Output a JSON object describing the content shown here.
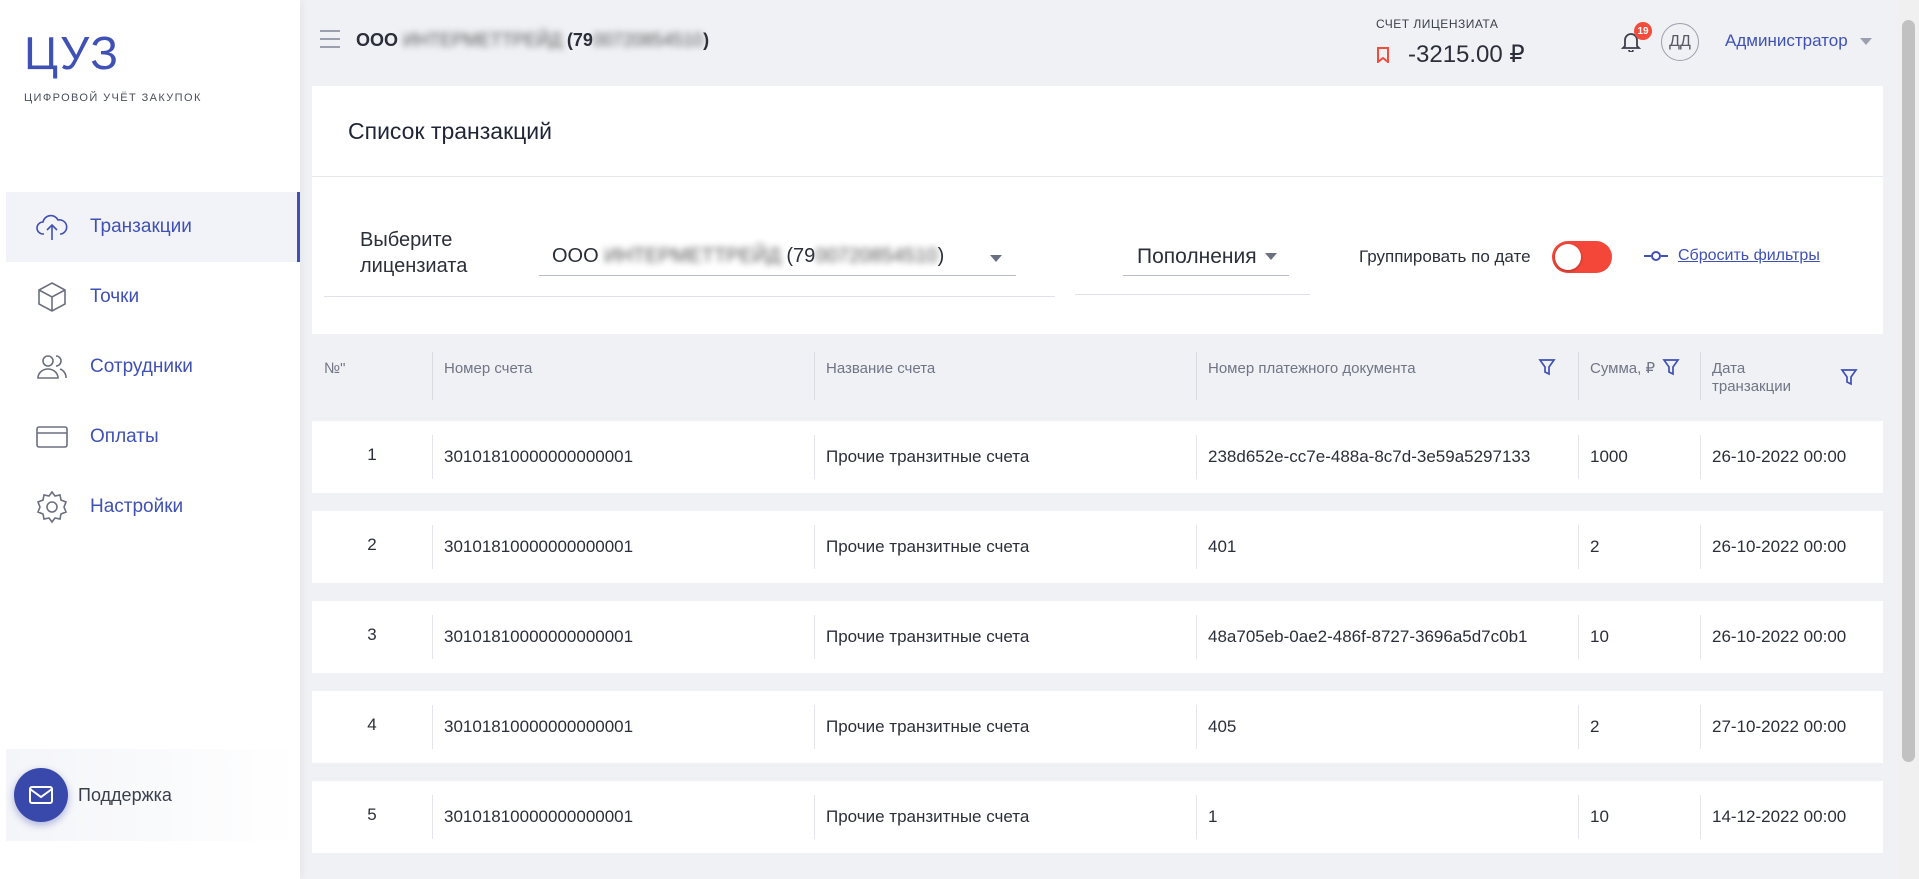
{
  "logo": {
    "title": "ЦУЗ",
    "subtitle": "ЦИФРОВОЙ УЧЁТ ЗАКУПОК"
  },
  "sidebar": {
    "items": [
      {
        "label": "Транзакции",
        "icon": "cloud-upload-icon",
        "active": true
      },
      {
        "label": "Точки",
        "icon": "cube-icon"
      },
      {
        "label": "Сотрудники",
        "icon": "users-icon"
      },
      {
        "label": "Оплаты",
        "icon": "credit-card-icon"
      },
      {
        "label": "Настройки",
        "icon": "gear-icon"
      }
    ],
    "support_label": "Поддержка"
  },
  "header": {
    "org_prefix": "ООО",
    "org_name_blurred": "ИНТЕРМЕТТРЕЙД",
    "org_inn_prefix": "(79",
    "org_inn_blurred": "00720854510",
    "org_inn_suffix": ")",
    "account_label": "СЧЕТ ЛИЦЕНЗИАТА",
    "account_value": "-3215.00 ₽",
    "notifications_count": "19",
    "avatar_initials": "ДД",
    "user_name": "Администратор"
  },
  "page": {
    "title": "Список транзакций"
  },
  "filters": {
    "licensee_label_line1": "Выберите",
    "licensee_label_line2": "лицензиата",
    "licensee_prefix": "ООО",
    "licensee_name_blurred": "ИНТЕРМЕТТРЕЙД",
    "licensee_inn_prefix": "(79",
    "licensee_inn_blurred": "00720854510",
    "licensee_inn_suffix": ")",
    "type_value": "Пополнения",
    "group_by_date_label": "Группировать по дате",
    "reset_label": "Сбросить фильтры"
  },
  "table": {
    "headers": {
      "num": "№\"",
      "account_number": "Номер счета",
      "account_name": "Название счета",
      "payment_doc": "Номер платежного документа",
      "amount": "Сумма, ₽",
      "date_line1": "Дата",
      "date_line2": "транзакции"
    },
    "rows": [
      {
        "num": "1",
        "account_number": "30101810000000000001",
        "account_name": "Прочие транзитные счета",
        "payment_doc": "238d652e-cc7e-488a-8c7d-3e59a5297133",
        "amount": "1000",
        "date": "26-10-2022 00:00"
      },
      {
        "num": "2",
        "account_number": "30101810000000000001",
        "account_name": "Прочие транзитные счета",
        "payment_doc": "401",
        "amount": "2",
        "date": "26-10-2022 00:00"
      },
      {
        "num": "3",
        "account_number": "30101810000000000001",
        "account_name": "Прочие транзитные счета",
        "payment_doc": "48a705eb-0ae2-486f-8727-3696a5d7c0b1",
        "amount": "10",
        "date": "26-10-2022 00:00"
      },
      {
        "num": "4",
        "account_number": "30101810000000000001",
        "account_name": "Прочие транзитные счета",
        "payment_doc": "405",
        "amount": "2",
        "date": "27-10-2022 00:00"
      },
      {
        "num": "5",
        "account_number": "30101810000000000001",
        "account_name": "Прочие транзитные счета",
        "payment_doc": "1",
        "amount": "10",
        "date": "14-12-2022 00:00"
      }
    ]
  },
  "colors": {
    "accent": "#3f51b5",
    "danger": "#f4473a"
  }
}
